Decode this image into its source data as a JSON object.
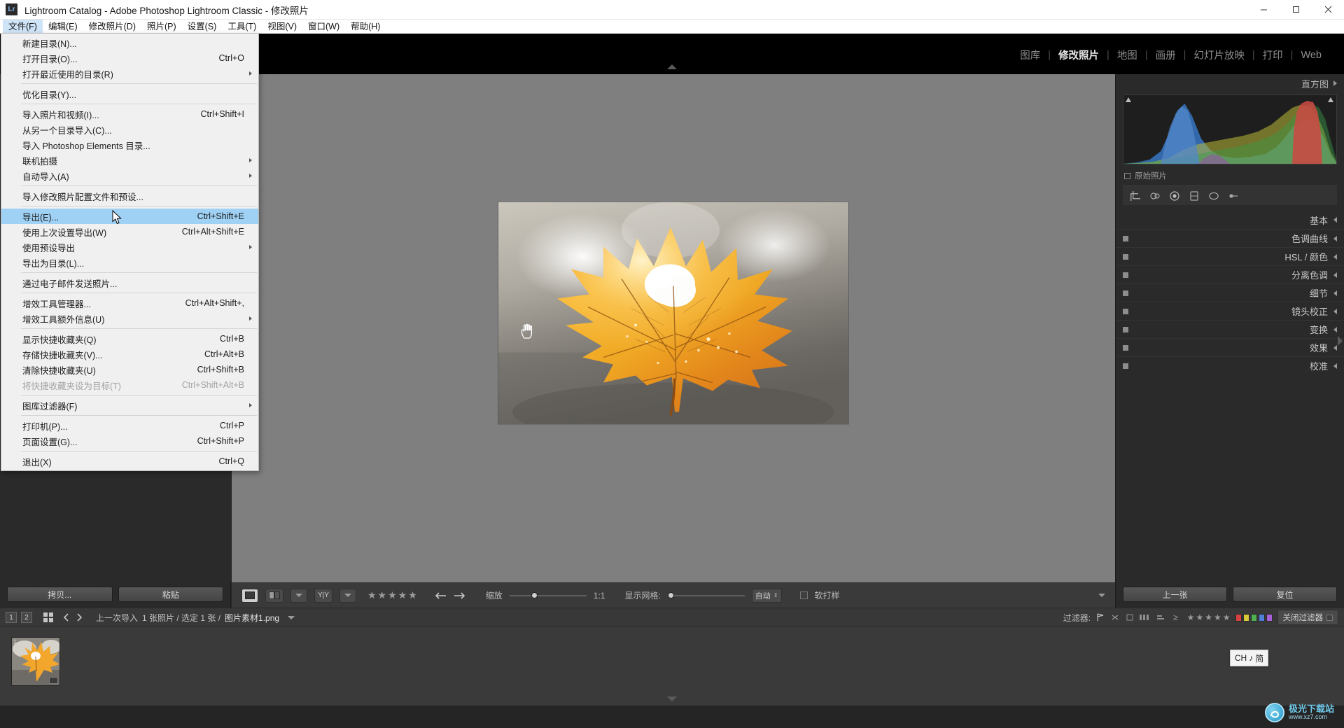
{
  "window": {
    "title": "Lightroom Catalog - Adobe Photoshop Lightroom Classic - 修改照片",
    "logo_text": "Lr",
    "minimize": "minimize-button",
    "maximize": "maximize-button",
    "close": "close-button"
  },
  "menubar": [
    {
      "label": "文件(F)",
      "active": true
    },
    {
      "label": "编辑(E)",
      "active": false
    },
    {
      "label": "修改照片(D)",
      "active": false
    },
    {
      "label": "照片(P)",
      "active": false
    },
    {
      "label": "设置(S)",
      "active": false
    },
    {
      "label": "工具(T)",
      "active": false
    },
    {
      "label": "视图(V)",
      "active": false
    },
    {
      "label": "窗口(W)",
      "active": false
    },
    {
      "label": "帮助(H)",
      "active": false
    }
  ],
  "file_menu": [
    {
      "type": "item",
      "label": "新建目录(N)...",
      "accel": "",
      "submenu": false,
      "disabled": false,
      "selected": false
    },
    {
      "type": "item",
      "label": "打开目录(O)...",
      "accel": "Ctrl+O",
      "submenu": false,
      "disabled": false,
      "selected": false
    },
    {
      "type": "item",
      "label": "打开最近使用的目录(R)",
      "accel": "",
      "submenu": true,
      "disabled": false,
      "selected": false
    },
    {
      "type": "sep"
    },
    {
      "type": "item",
      "label": "优化目录(Y)...",
      "accel": "",
      "submenu": false,
      "disabled": false,
      "selected": false
    },
    {
      "type": "sep"
    },
    {
      "type": "item",
      "label": "导入照片和视频(I)...",
      "accel": "Ctrl+Shift+I",
      "submenu": false,
      "disabled": false,
      "selected": false
    },
    {
      "type": "item",
      "label": "从另一个目录导入(C)...",
      "accel": "",
      "submenu": false,
      "disabled": false,
      "selected": false
    },
    {
      "type": "item",
      "label": "导入 Photoshop Elements 目录...",
      "accel": "",
      "submenu": false,
      "disabled": false,
      "selected": false
    },
    {
      "type": "item",
      "label": "联机拍摄",
      "accel": "",
      "submenu": true,
      "disabled": false,
      "selected": false
    },
    {
      "type": "item",
      "label": "自动导入(A)",
      "accel": "",
      "submenu": true,
      "disabled": false,
      "selected": false
    },
    {
      "type": "sep"
    },
    {
      "type": "item",
      "label": "导入修改照片配置文件和预设...",
      "accel": "",
      "submenu": false,
      "disabled": false,
      "selected": false
    },
    {
      "type": "sep"
    },
    {
      "type": "item",
      "label": "导出(E)...",
      "accel": "Ctrl+Shift+E",
      "submenu": false,
      "disabled": false,
      "selected": true
    },
    {
      "type": "item",
      "label": "使用上次设置导出(W)",
      "accel": "Ctrl+Alt+Shift+E",
      "submenu": false,
      "disabled": false,
      "selected": false
    },
    {
      "type": "item",
      "label": "使用预设导出",
      "accel": "",
      "submenu": true,
      "disabled": false,
      "selected": false
    },
    {
      "type": "item",
      "label": "导出为目录(L)...",
      "accel": "",
      "submenu": false,
      "disabled": false,
      "selected": false
    },
    {
      "type": "sep"
    },
    {
      "type": "item",
      "label": "通过电子邮件发送照片...",
      "accel": "",
      "submenu": false,
      "disabled": false,
      "selected": false
    },
    {
      "type": "sep"
    },
    {
      "type": "item",
      "label": "增效工具管理器...",
      "accel": "Ctrl+Alt+Shift+,",
      "submenu": false,
      "disabled": false,
      "selected": false
    },
    {
      "type": "item",
      "label": "增效工具额外信息(U)",
      "accel": "",
      "submenu": true,
      "disabled": false,
      "selected": false
    },
    {
      "type": "sep"
    },
    {
      "type": "item",
      "label": "显示快捷收藏夹(Q)",
      "accel": "Ctrl+B",
      "submenu": false,
      "disabled": false,
      "selected": false
    },
    {
      "type": "item",
      "label": "存储快捷收藏夹(V)...",
      "accel": "Ctrl+Alt+B",
      "submenu": false,
      "disabled": false,
      "selected": false
    },
    {
      "type": "item",
      "label": "清除快捷收藏夹(U)",
      "accel": "Ctrl+Shift+B",
      "submenu": false,
      "disabled": false,
      "selected": false
    },
    {
      "type": "item",
      "label": "将快捷收藏夹设为目标(T)",
      "accel": "Ctrl+Shift+Alt+B",
      "submenu": false,
      "disabled": true,
      "selected": false
    },
    {
      "type": "sep"
    },
    {
      "type": "item",
      "label": "图库过滤器(F)",
      "accel": "",
      "submenu": true,
      "disabled": false,
      "selected": false
    },
    {
      "type": "sep"
    },
    {
      "type": "item",
      "label": "打印机(P)...",
      "accel": "Ctrl+P",
      "submenu": false,
      "disabled": false,
      "selected": false
    },
    {
      "type": "item",
      "label": "页面设置(G)...",
      "accel": "Ctrl+Shift+P",
      "submenu": false,
      "disabled": false,
      "selected": false
    },
    {
      "type": "sep"
    },
    {
      "type": "item",
      "label": "退出(X)",
      "accel": "Ctrl+Q",
      "submenu": false,
      "disabled": false,
      "selected": false
    }
  ],
  "modules": [
    {
      "label": "图库",
      "active": false
    },
    {
      "label": "修改照片",
      "active": true
    },
    {
      "label": "地图",
      "active": false
    },
    {
      "label": "画册",
      "active": false
    },
    {
      "label": "幻灯片放映",
      "active": false
    },
    {
      "label": "打印",
      "active": false
    },
    {
      "label": "Web",
      "active": false
    }
  ],
  "right_panel": {
    "histogram_title": "直方图",
    "histogram_left_value": "",
    "histogram_right_value": "",
    "original_photo_label": "原始照片",
    "sections": [
      {
        "label": "基本"
      },
      {
        "label": "色调曲线"
      },
      {
        "label": "HSL / 颜色"
      },
      {
        "label": "分离色调"
      },
      {
        "label": "细节"
      },
      {
        "label": "镜头校正"
      },
      {
        "label": "变换"
      },
      {
        "label": "效果"
      },
      {
        "label": "校准"
      }
    ],
    "buttons": [
      {
        "label": "上一张"
      },
      {
        "label": "复位"
      }
    ]
  },
  "left_panel": {
    "buttons": [
      {
        "label": "拷贝..."
      },
      {
        "label": "粘贴"
      }
    ]
  },
  "toolbar": {
    "zoom_label": "缩放",
    "zoom_ratio": "1:1",
    "grid_label": "显示网格:",
    "grid_value": "自动",
    "soft_proof_label": "软打样",
    "rating_stars": 5,
    "prev_icon": "arrow-left-icon",
    "next_icon": "arrow-right-icon"
  },
  "filmstrip_bar": {
    "page_numbers": [
      "1",
      "2"
    ],
    "import_text": "上一次导入 ",
    "counts_text": "1 张照片 / 选定 1 张 / ",
    "filename": "图片素材1.png",
    "filter_label": "过滤器:",
    "close_filter_label": "关闭过滤器",
    "swatch_colors": [
      "#d94040",
      "#d9c83c",
      "#4fb04f",
      "#4f7fd9",
      "#a85fd9"
    ]
  },
  "filmstrip": {
    "thumbnail_badge": "1"
  },
  "ime": {
    "label": "CH",
    "note": "简",
    "music_glyph": "♪"
  },
  "watermark": {
    "title": "极光下载站",
    "url": "www.xz7.com"
  },
  "colors": {
    "accent_selection": "#9fd1f5",
    "panel_bg": "#2a2a2a",
    "stage_bg": "#7f7f7f",
    "titlebar_bg": "#ffffff",
    "topbar_bg": "#000000"
  }
}
